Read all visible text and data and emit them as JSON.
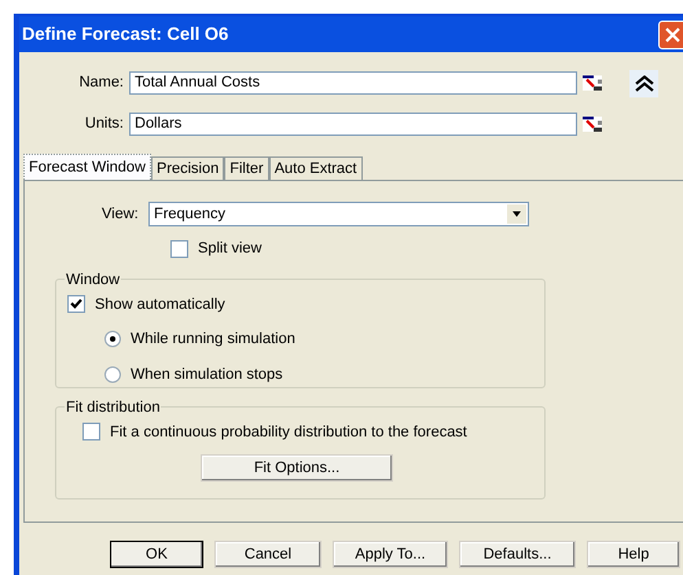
{
  "window": {
    "title": "Define Forecast: Cell O6"
  },
  "fields": [
    {
      "label": "Name:",
      "value": "Total Annual Costs"
    },
    {
      "label": "Units:",
      "value": "Dollars"
    }
  ],
  "tabs": [
    {
      "label": "Forecast Window",
      "selected": true
    },
    {
      "label": "Precision",
      "selected": false
    },
    {
      "label": "Filter",
      "selected": false
    },
    {
      "label": "Auto Extract",
      "selected": false
    }
  ],
  "view": {
    "label": "View:",
    "value": "Frequency"
  },
  "split_view": {
    "label": "Split view",
    "checked": false
  },
  "window_group": {
    "title": "Window",
    "show_automatically": {
      "label": "Show automatically",
      "checked": true
    },
    "options": [
      {
        "label": "While running simulation",
        "selected": true
      },
      {
        "label": "When simulation stops",
        "selected": false
      }
    ]
  },
  "fit_group": {
    "title": "Fit distribution",
    "fit": {
      "label": "Fit a continuous probability distribution to the forecast",
      "checked": false
    },
    "button": "Fit Options..."
  },
  "buttons": [
    {
      "label": "OK",
      "default": true
    },
    {
      "label": "Cancel",
      "default": false
    },
    {
      "label": "Apply To...",
      "default": false
    },
    {
      "label": "Defaults...",
      "default": false
    },
    {
      "label": "Help",
      "default": false
    }
  ]
}
